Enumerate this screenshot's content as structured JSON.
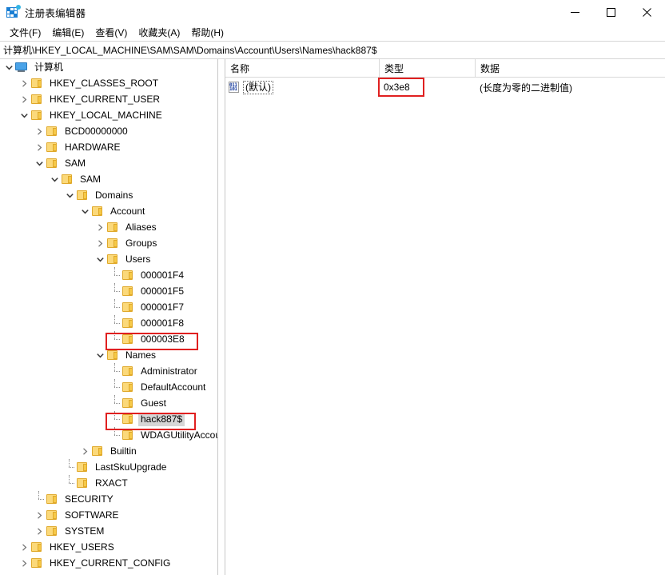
{
  "window": {
    "title": "注册表编辑器",
    "app_icon": "registry-editor-icon",
    "minimize": "minimize-icon",
    "maximize": "maximize-icon",
    "close": "close-icon"
  },
  "menubar": {
    "items": [
      {
        "label": "文件(F)"
      },
      {
        "label": "编辑(E)"
      },
      {
        "label": "查看(V)"
      },
      {
        "label": "收藏夹(A)"
      },
      {
        "label": "帮助(H)"
      }
    ]
  },
  "address": {
    "path": "计算机\\HKEY_LOCAL_MACHINE\\SAM\\SAM\\Domains\\Account\\Users\\Names\\hack887$"
  },
  "tree": {
    "nodes": [
      {
        "label": "计算机",
        "indent": 0,
        "state": "expanded",
        "icon": "computer-icon"
      },
      {
        "label": "HKEY_CLASSES_ROOT",
        "indent": 1,
        "state": "collapsed",
        "icon": "folder-icon"
      },
      {
        "label": "HKEY_CURRENT_USER",
        "indent": 1,
        "state": "collapsed",
        "icon": "folder-icon"
      },
      {
        "label": "HKEY_LOCAL_MACHINE",
        "indent": 1,
        "state": "expanded",
        "icon": "folder-icon"
      },
      {
        "label": "BCD00000000",
        "indent": 2,
        "state": "collapsed",
        "icon": "folder-icon"
      },
      {
        "label": "HARDWARE",
        "indent": 2,
        "state": "collapsed",
        "icon": "folder-icon"
      },
      {
        "label": "SAM",
        "indent": 2,
        "state": "expanded",
        "icon": "folder-icon"
      },
      {
        "label": "SAM",
        "indent": 3,
        "state": "expanded",
        "icon": "folder-icon"
      },
      {
        "label": "Domains",
        "indent": 4,
        "state": "expanded",
        "icon": "folder-icon"
      },
      {
        "label": "Account",
        "indent": 5,
        "state": "expanded",
        "icon": "folder-icon"
      },
      {
        "label": "Aliases",
        "indent": 6,
        "state": "collapsed",
        "icon": "folder-icon"
      },
      {
        "label": "Groups",
        "indent": 6,
        "state": "collapsed",
        "icon": "folder-icon"
      },
      {
        "label": "Users",
        "indent": 6,
        "state": "expanded",
        "icon": "folder-icon"
      },
      {
        "label": "000001F4",
        "indent": 7,
        "state": "leaf",
        "icon": "folder-icon"
      },
      {
        "label": "000001F5",
        "indent": 7,
        "state": "leaf",
        "icon": "folder-icon"
      },
      {
        "label": "000001F7",
        "indent": 7,
        "state": "leaf",
        "icon": "folder-icon"
      },
      {
        "label": "000001F8",
        "indent": 7,
        "state": "leaf",
        "icon": "folder-icon"
      },
      {
        "label": "000003E8",
        "indent": 7,
        "state": "leaf",
        "icon": "folder-icon",
        "highlight": "red-box"
      },
      {
        "label": "Names",
        "indent": 6,
        "state": "expanded",
        "icon": "folder-icon"
      },
      {
        "label": "Administrator",
        "indent": 7,
        "state": "leaf",
        "icon": "folder-icon"
      },
      {
        "label": "DefaultAccount",
        "indent": 7,
        "state": "leaf",
        "icon": "folder-icon"
      },
      {
        "label": "Guest",
        "indent": 7,
        "state": "leaf",
        "icon": "folder-icon"
      },
      {
        "label": "hack887$",
        "indent": 7,
        "state": "leaf",
        "icon": "folder-icon",
        "selected": true,
        "highlight": "red-box"
      },
      {
        "label": "WDAGUtilityAccount",
        "indent": 7,
        "state": "leaf",
        "icon": "folder-icon"
      },
      {
        "label": "Builtin",
        "indent": 5,
        "state": "collapsed",
        "icon": "folder-icon"
      },
      {
        "label": "LastSkuUpgrade",
        "indent": 4,
        "state": "leaf",
        "icon": "folder-icon"
      },
      {
        "label": "RXACT",
        "indent": 4,
        "state": "leaf",
        "icon": "folder-icon"
      },
      {
        "label": "SECURITY",
        "indent": 2,
        "state": "leaf",
        "icon": "folder-icon"
      },
      {
        "label": "SOFTWARE",
        "indent": 2,
        "state": "collapsed",
        "icon": "folder-icon"
      },
      {
        "label": "SYSTEM",
        "indent": 2,
        "state": "collapsed",
        "icon": "folder-icon"
      },
      {
        "label": "HKEY_USERS",
        "indent": 1,
        "state": "collapsed",
        "icon": "folder-icon"
      },
      {
        "label": "HKEY_CURRENT_CONFIG",
        "indent": 1,
        "state": "collapsed",
        "icon": "folder-icon"
      }
    ]
  },
  "list": {
    "columns": [
      {
        "label": "名称"
      },
      {
        "label": "类型"
      },
      {
        "label": "数据"
      }
    ],
    "rows": [
      {
        "name": "(默认)",
        "type": "0x3e8",
        "data": "(长度为零的二进制值)",
        "icon": "binary-value-icon",
        "name_focused": true,
        "type_highlight": "red-box"
      }
    ]
  },
  "annotations": {
    "color": "#e02020",
    "boxes": [
      {
        "target": "tree-node-000003E8"
      },
      {
        "target": "tree-node-hack887$"
      },
      {
        "target": "list-cell-type-0x3e8"
      }
    ]
  }
}
